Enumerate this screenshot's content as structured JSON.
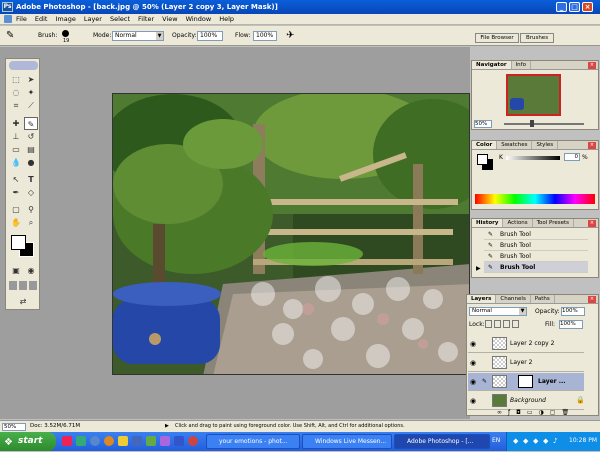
{
  "window": {
    "title": "Adobe Photoshop - [back.jpg @ 50% (Layer 2 copy 3, Layer Mask)]",
    "buttons": [
      "_",
      "□",
      "×"
    ]
  },
  "menu": [
    "File",
    "Edit",
    "Image",
    "Layer",
    "Select",
    "Filter",
    "View",
    "Window",
    "Help"
  ],
  "options": {
    "brush_label": "Brush:",
    "brush_size": "19",
    "mode_label": "Mode:",
    "mode_value": "Normal",
    "opacity_label": "Opacity:",
    "opacity_value": "100%",
    "flow_label": "Flow:",
    "flow_value": "100%",
    "file_browser_tab": "File Browser",
    "brushes_tab": "Brushes"
  },
  "navigator": {
    "tabs": [
      "Navigator",
      "Info"
    ],
    "zoom": "50%"
  },
  "color": {
    "tabs": [
      "Color",
      "Swatches",
      "Styles"
    ],
    "k_label": "K",
    "k_value": "0",
    "k_unit": "%"
  },
  "history": {
    "tabs": [
      "History",
      "Actions",
      "Tool Presets"
    ],
    "items": [
      "Brush Tool",
      "Brush Tool",
      "Brush Tool",
      "Brush Tool"
    ]
  },
  "layers": {
    "tabs": [
      "Layers",
      "Channels",
      "Paths"
    ],
    "blend_mode": "Normal",
    "opacity_label": "Opacity:",
    "opacity_value": "100%",
    "lock_label": "Lock:",
    "fill_label": "Fill:",
    "fill_value": "100%",
    "items": [
      {
        "name": "Layer 2 copy 2"
      },
      {
        "name": "Layer 2"
      },
      {
        "name": "Layer ..."
      },
      {
        "name": "Background"
      }
    ]
  },
  "status": {
    "zoom": "50%",
    "doc": "Doc: 3.52M/6.71M",
    "hint": "Click and drag to paint using foreground color. Use Shift, Alt, and Ctrl for additional options."
  },
  "taskbar": {
    "start": "start",
    "buttons": [
      "your emotions - phot...",
      "Windows Live Messen...",
      "Adobe Photoshop - [..."
    ],
    "lang": "EN",
    "clock": "10:28 PM"
  },
  "colors": {
    "xp_blue": "#245edb",
    "start_green": "#2e8a2e",
    "panel_bg": "#ece9d8",
    "workspace": "#9e9e9e"
  }
}
